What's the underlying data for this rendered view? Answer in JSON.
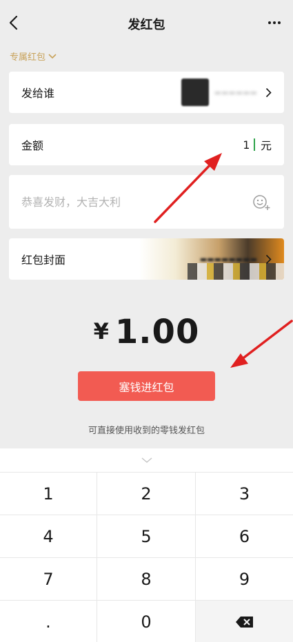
{
  "header": {
    "title": "发红包"
  },
  "packet_type": {
    "label": "专属红包"
  },
  "recipient": {
    "label": "发给谁"
  },
  "amount": {
    "label": "金额",
    "value": "1",
    "unit": "元"
  },
  "message": {
    "placeholder": "恭喜发财，大吉大利"
  },
  "cover": {
    "label": "红包封面"
  },
  "total": {
    "symbol": "¥",
    "value": "1.00"
  },
  "send_button": {
    "label": "塞钱进红包"
  },
  "hint": "可直接使用收到的零钱发红包",
  "keypad": {
    "keys": [
      "1",
      "2",
      "3",
      "4",
      "5",
      "6",
      "7",
      "8",
      "9",
      ".",
      "0"
    ]
  },
  "colors": {
    "accent_red": "#f25b52",
    "gold": "#c8a25a",
    "annotation_arrow": "#e02020"
  }
}
